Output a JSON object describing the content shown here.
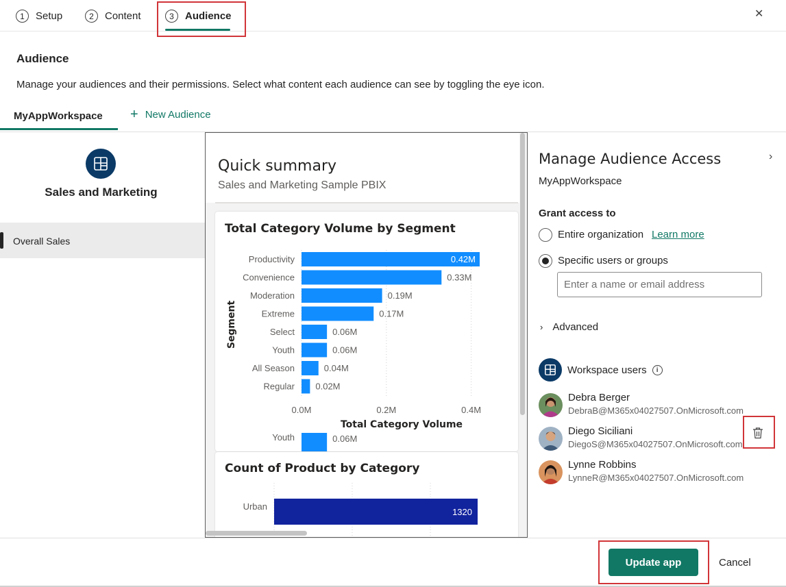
{
  "steps": [
    {
      "num": "1",
      "label": "Setup"
    },
    {
      "num": "2",
      "label": "Content"
    },
    {
      "num": "3",
      "label": "Audience"
    }
  ],
  "header": {
    "title": "Audience",
    "description": "Manage your audiences and their permissions. Select what content each audience can see by toggling the eye icon."
  },
  "audience_tabs": {
    "active": "MyAppWorkspace",
    "new_label": "New Audience"
  },
  "left_nav": {
    "app_name": "Sales and Marketing",
    "items": [
      {
        "label": "Overall Sales",
        "selected": true
      }
    ]
  },
  "report": {
    "title": "Quick summary",
    "subtitle": "Sales and Marketing Sample PBIX"
  },
  "chart_data": [
    {
      "type": "bar",
      "orientation": "horizontal",
      "title": "Total Category Volume by Segment",
      "xlabel": "Total Category Volume",
      "ylabel": "Segment",
      "categories": [
        "Productivity",
        "Convenience",
        "Moderation",
        "Extreme",
        "Select",
        "Youth",
        "All Season",
        "Regular"
      ],
      "values": [
        0.42,
        0.33,
        0.19,
        0.17,
        0.06,
        0.06,
        0.04,
        0.02
      ],
      "value_labels": [
        "0.42M",
        "0.33M",
        "0.19M",
        "0.17M",
        "0.06M",
        "0.06M",
        "0.04M",
        "0.02M"
      ],
      "x_ticks": [
        "0.0M",
        "0.2M",
        "0.4M"
      ],
      "xlim": [
        0,
        0.42
      ],
      "color": "#118dff",
      "overflow_row": {
        "category": "Youth",
        "value": 0.06,
        "label": "0.06M"
      }
    },
    {
      "type": "bar",
      "orientation": "horizontal",
      "title": "Count of Product by Category",
      "categories": [
        "Urban"
      ],
      "values": [
        1320
      ],
      "value_labels": [
        "1320"
      ],
      "color": "#12239e"
    }
  ],
  "manage_panel": {
    "title": "Manage Audience Access",
    "workspace": "MyAppWorkspace",
    "grant_label": "Grant access to",
    "options": [
      {
        "label": "Entire organization",
        "checked": false
      },
      {
        "label": "Specific users or groups",
        "checked": true
      }
    ],
    "learn_more": "Learn more",
    "input_placeholder": "Enter a name or email address",
    "advanced_label": "Advanced",
    "workspace_users_label": "Workspace users",
    "users": [
      {
        "name": "Debra Berger",
        "email": "DebraB@M365x04027507.OnMicrosoft.com",
        "avatar_bg": "#7a5a3e",
        "shirt": "#b03a8a"
      },
      {
        "name": "Diego Siciliani",
        "email": "DiegoS@M365x04027507.OnMicrosoft.com",
        "avatar_bg": "#8aa0b5",
        "shirt": "#3e5a78"
      },
      {
        "name": "Lynne Robbins",
        "email": "LynneR@M365x04027507.OnMicrosoft.com",
        "avatar_bg": "#c97a4a",
        "shirt": "#c33c2c"
      }
    ]
  },
  "footer": {
    "update_label": "Update app",
    "cancel_label": "Cancel"
  },
  "colors": {
    "accent": "#117865",
    "highlight": "#d13438",
    "logo": "#0b3a66"
  }
}
